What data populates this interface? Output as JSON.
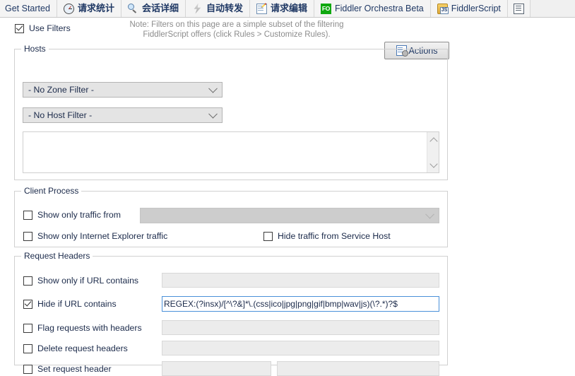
{
  "tabs": [
    {
      "label": "Get Started",
      "icon": null,
      "cjk": false
    },
    {
      "label": "请求统计",
      "icon": "clock-stats-icon",
      "cjk": true
    },
    {
      "label": "会话详细",
      "icon": "magnifier-icon",
      "cjk": true
    },
    {
      "label": "自动转发",
      "icon": "lightning-bolt-icon",
      "cjk": true
    },
    {
      "label": "请求编辑",
      "icon": "pencil-edit-icon",
      "cjk": true
    },
    {
      "label": "Fiddler Orchestra Beta",
      "icon": "fo-badge-icon",
      "cjk": false
    },
    {
      "label": "FiddlerScript",
      "icon": "js-script-icon",
      "cjk": false
    },
    {
      "label": "",
      "icon": "log-list-icon",
      "cjk": false
    }
  ],
  "header": {
    "use_filters_label": "Use Filters",
    "use_filters_checked": true,
    "note_line1": "Note: Filters on this page are a simple subset of the filtering",
    "note_line2": "FiddlerScript offers (click Rules > Customize Rules).",
    "actions_label": "Actions"
  },
  "hosts": {
    "title": "Hosts",
    "zone_filter_value": "- No Zone Filter -",
    "host_filter_value": "- No Host Filter -",
    "host_list_value": ""
  },
  "client_process": {
    "title": "Client Process",
    "show_only_traffic_from_label": "Show only traffic from",
    "show_only_traffic_from_checked": false,
    "process_combo_value": "",
    "show_only_ie_label": "Show only Internet Explorer traffic",
    "show_only_ie_checked": false,
    "hide_service_host_label": "Hide traffic from Service Host",
    "hide_service_host_checked": false
  },
  "request_headers": {
    "title": "Request Headers",
    "rows": [
      {
        "label": "Show only if URL contains",
        "checked": false,
        "value": "",
        "enabled": false
      },
      {
        "label": "Hide if URL contains",
        "checked": true,
        "value": "REGEX:(?insx)/[^\\?&]*\\.(css|ico|jpg|png|gif|bmp|wav|js)(\\?.*)?$",
        "enabled": true
      },
      {
        "label": "Flag requests with headers",
        "checked": false,
        "value": "",
        "enabled": false
      },
      {
        "label": "Delete request headers",
        "checked": false,
        "value": "",
        "enabled": false
      },
      {
        "label": "Set request header",
        "checked": false,
        "value": "",
        "value2": "",
        "enabled": false
      }
    ]
  },
  "colors": {
    "accent_blue": "#4a90d9",
    "text_navy": "#1b2a4a",
    "tab_text": "#1f3864",
    "note_gray": "#8c8c8c",
    "fo_green": "#0fa80f",
    "disabled_gray": "#cdcdcd"
  }
}
